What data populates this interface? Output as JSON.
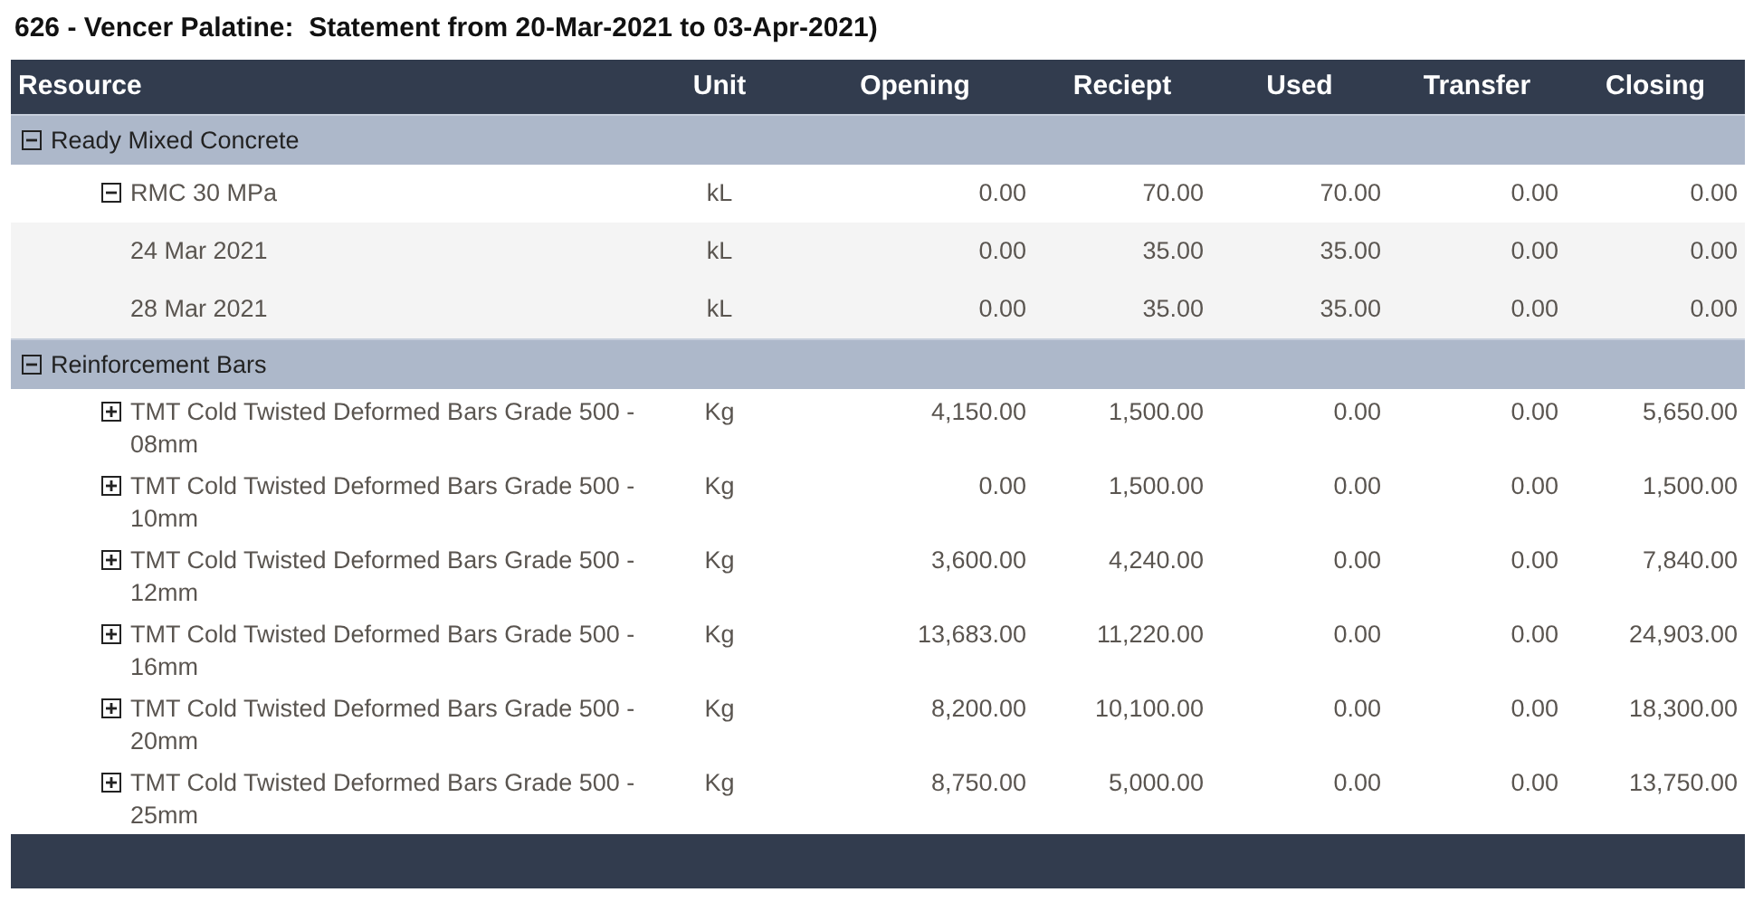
{
  "title": "626 - Vencer Palatine:  Statement from 20-Mar-2021 to 03-Apr-2021)",
  "columns": [
    "Resource",
    "Unit",
    "Opening",
    "Reciept",
    "Used",
    "Transfer",
    "Closing"
  ],
  "groups": [
    {
      "name": "Ready Mixed Concrete",
      "expanded": true,
      "children": [
        {
          "name": "RMC 30 MPa",
          "unit": "kL",
          "values": [
            "0.00",
            "70.00",
            "70.00",
            "0.00",
            "0.00"
          ],
          "expanded": true,
          "children": [
            {
              "name": "24 Mar 2021",
              "unit": "kL",
              "values": [
                "0.00",
                "35.00",
                "35.00",
                "0.00",
                "0.00"
              ]
            },
            {
              "name": "28 Mar 2021",
              "unit": "kL",
              "values": [
                "0.00",
                "35.00",
                "35.00",
                "0.00",
                "0.00"
              ]
            }
          ]
        }
      ]
    },
    {
      "name": "Reinforcement Bars",
      "expanded": true,
      "children": [
        {
          "name": "TMT Cold Twisted Deformed Bars Grade 500 - 08mm",
          "unit": "Kg",
          "values": [
            "4,150.00",
            "1,500.00",
            "0.00",
            "0.00",
            "5,650.00"
          ],
          "expanded": false
        },
        {
          "name": "TMT Cold Twisted Deformed Bars Grade 500 - 10mm",
          "unit": "Kg",
          "values": [
            "0.00",
            "1,500.00",
            "0.00",
            "0.00",
            "1,500.00"
          ],
          "expanded": false
        },
        {
          "name": "TMT Cold Twisted Deformed Bars Grade 500 - 12mm",
          "unit": "Kg",
          "values": [
            "3,600.00",
            "4,240.00",
            "0.00",
            "0.00",
            "7,840.00"
          ],
          "expanded": false
        },
        {
          "name": "TMT Cold Twisted Deformed Bars Grade 500 - 16mm",
          "unit": "Kg",
          "values": [
            "13,683.00",
            "11,220.00",
            "0.00",
            "0.00",
            "24,903.00"
          ],
          "expanded": false
        },
        {
          "name": "TMT Cold Twisted Deformed Bars Grade 500 - 20mm",
          "unit": "Kg",
          "values": [
            "8,200.00",
            "10,100.00",
            "0.00",
            "0.00",
            "18,300.00"
          ],
          "expanded": false
        },
        {
          "name": "TMT Cold Twisted Deformed Bars Grade 500 - 25mm",
          "unit": "Kg",
          "values": [
            "8,750.00",
            "5,000.00",
            "0.00",
            "0.00",
            "13,750.00"
          ],
          "expanded": false
        }
      ]
    }
  ]
}
